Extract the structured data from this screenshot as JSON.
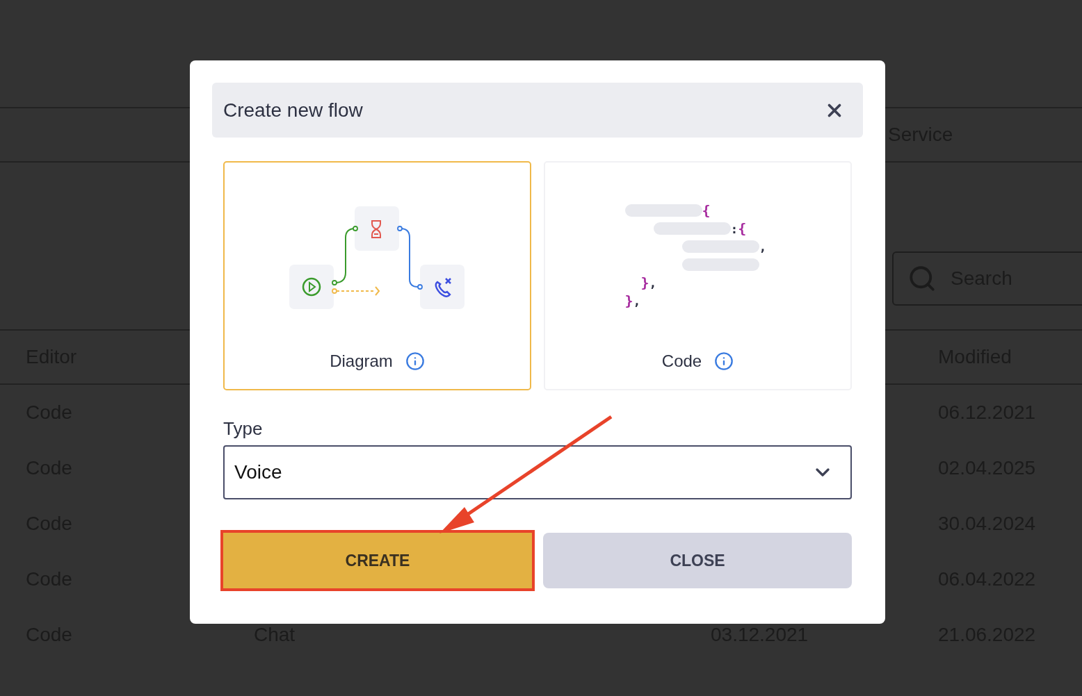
{
  "background": {
    "header_label": "Service",
    "search": {
      "placeholder": "Search"
    },
    "table": {
      "columns": [
        "Editor",
        "Modified"
      ],
      "rows": [
        {
          "editor": "Code",
          "modified": "06.12.2021"
        },
        {
          "editor": "Code",
          "modified": "02.04.2025"
        },
        {
          "editor": "Code",
          "modified": "30.04.2024"
        },
        {
          "editor": "Code",
          "modified": "06.04.2022"
        },
        {
          "editor": "Code",
          "column_2": "Chat",
          "column_3": "03.12.2021",
          "modified": "21.06.2022"
        }
      ]
    }
  },
  "dialog": {
    "title": "Create new flow",
    "options": [
      {
        "kind": "diagram",
        "label": "Diagram",
        "selected": true
      },
      {
        "kind": "code",
        "label": "Code",
        "selected": false,
        "code_lines": [
          {
            "kind": "open",
            "brace": "{"
          },
          {
            "kind": "open",
            "punct": ":",
            "brace": "{"
          },
          {
            "kind": "item",
            "punct": ","
          },
          {
            "kind": "item"
          },
          {
            "kind": "close",
            "brace": "}",
            "punct": ","
          },
          {
            "kind": "close",
            "brace": "}",
            "punct": ","
          }
        ]
      }
    ],
    "type_field": {
      "label": "Type",
      "value": "Voice"
    },
    "buttons": [
      {
        "kind": "primary",
        "label": "CREATE",
        "highlighted": true
      },
      {
        "kind": "secondary",
        "label": "CLOSE",
        "highlighted": false
      }
    ]
  },
  "annotations": [
    {
      "kind": "arrow"
    }
  ]
}
